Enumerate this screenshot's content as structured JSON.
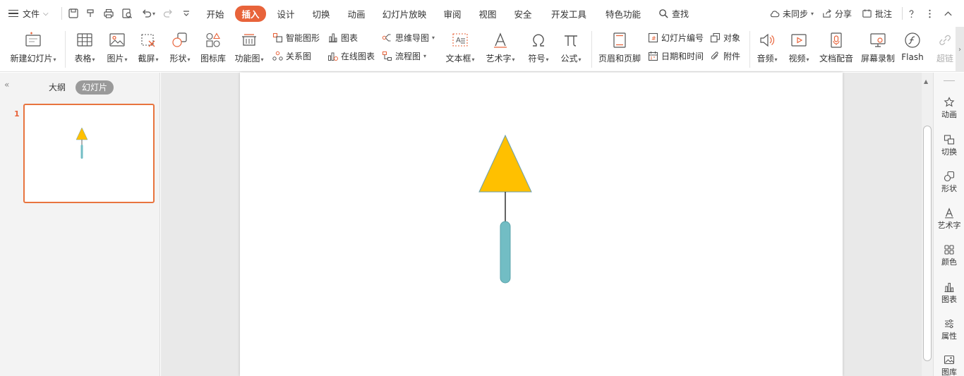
{
  "menu": {
    "file_label": "文件",
    "tabs": [
      {
        "label": "开始",
        "active": false
      },
      {
        "label": "插入",
        "active": true
      },
      {
        "label": "设计",
        "active": false
      },
      {
        "label": "切换",
        "active": false
      },
      {
        "label": "动画",
        "active": false
      },
      {
        "label": "幻灯片放映",
        "active": false
      },
      {
        "label": "审阅",
        "active": false
      },
      {
        "label": "视图",
        "active": false
      },
      {
        "label": "安全",
        "active": false
      },
      {
        "label": "开发工具",
        "active": false
      },
      {
        "label": "特色功能",
        "active": false
      }
    ],
    "search_label": "查找",
    "sync_label": "未同步",
    "share_label": "分享",
    "comment_label": "批注"
  },
  "ribbon": {
    "new_slide": "新建幻灯片",
    "table": "表格",
    "picture": "图片",
    "screenshot": "截屏",
    "shape": "形状",
    "icon_library": "图标库",
    "function_chart": "功能图",
    "smart_art": "智能图形",
    "chart": "图表",
    "relation_chart": "关系图",
    "online_chart": "在线图表",
    "mind_map": "思维导图",
    "flow_chart": "流程图",
    "text_box": "文本框",
    "word_art": "艺术字",
    "symbol": "符号",
    "formula": "公式",
    "header_footer": "页眉和页脚",
    "slide_number": "幻灯片编号",
    "object": "对象",
    "date_time": "日期和时间",
    "attachment": "附件",
    "audio": "音频",
    "video": "视频",
    "doc_voice": "文档配音",
    "screen_record": "屏幕录制",
    "flash": "Flash",
    "hyperlink": "超链"
  },
  "left_panel": {
    "outline_tab": "大纲",
    "slides_tab": "幻灯片",
    "slide_number": "1"
  },
  "task_pane": {
    "items": [
      "动画",
      "切换",
      "形状",
      "艺术字",
      "颜色",
      "图表",
      "属性",
      "图库"
    ]
  },
  "colors": {
    "accent": "#e8633a",
    "triangle_fill": "#ffc000",
    "triangle_stroke": "#6b9fb0",
    "handle_fill": "#72bdc4",
    "handle_stroke": "#5aa3ab"
  }
}
